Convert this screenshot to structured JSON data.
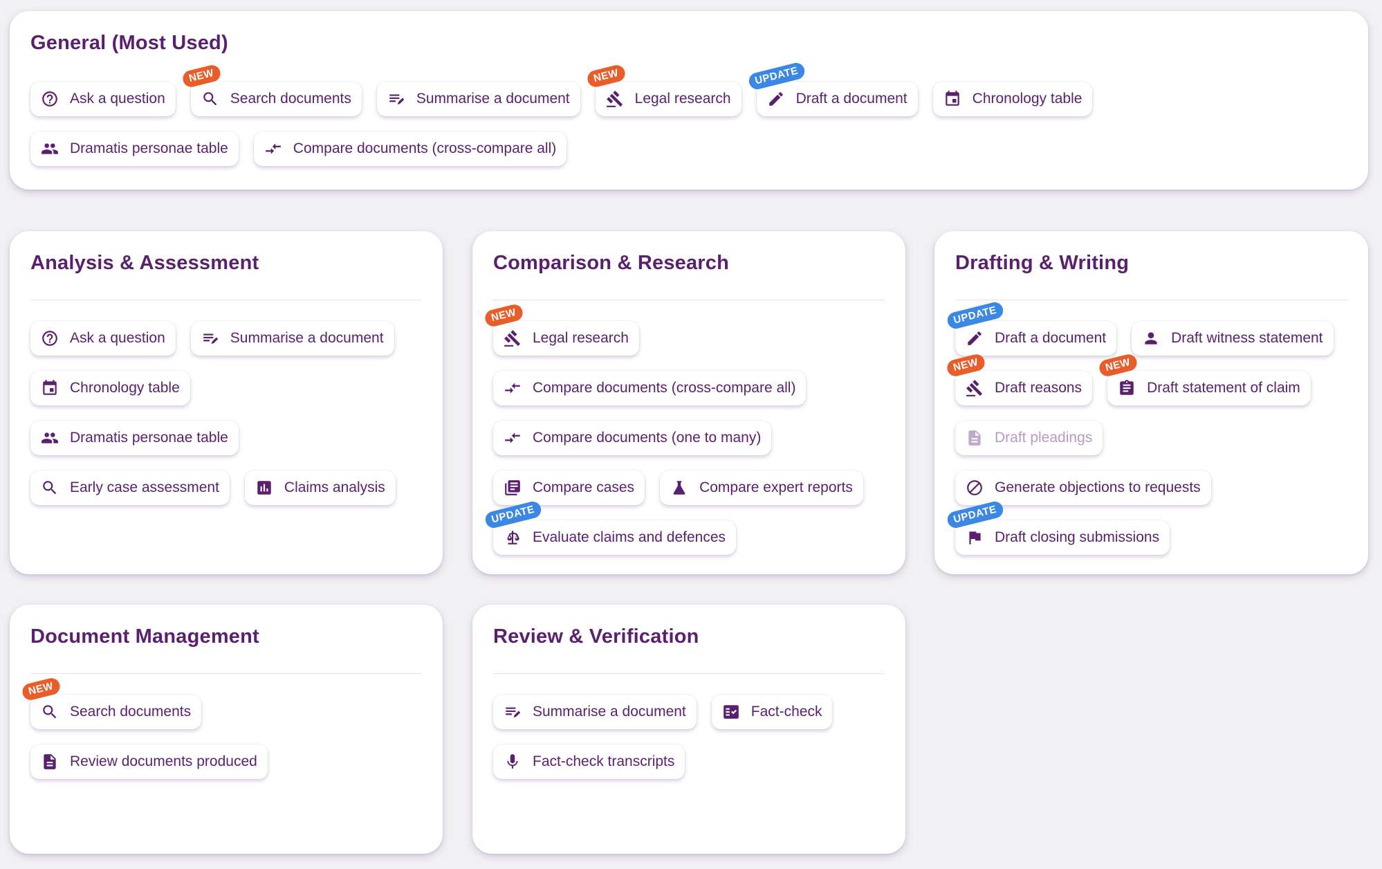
{
  "badges": {
    "new": "NEW",
    "update": "UPDATE"
  },
  "general": {
    "title": "General (Most Used)",
    "row1": [
      {
        "label": "Ask a question",
        "icon": "help-circle"
      },
      {
        "label": "Search documents",
        "icon": "search",
        "badge": "NEW"
      },
      {
        "label": "Summarise a document",
        "icon": "summarise"
      },
      {
        "label": "Legal research",
        "icon": "gavel",
        "badge": "NEW"
      },
      {
        "label": "Draft a document",
        "icon": "pencil",
        "badge": "UPDATE"
      },
      {
        "label": "Chronology table",
        "icon": "calendar"
      }
    ],
    "row2": [
      {
        "label": "Dramatis personae table",
        "icon": "people"
      },
      {
        "label": "Compare documents (cross-compare all)",
        "icon": "compare-arrows"
      }
    ]
  },
  "analysis": {
    "title": "Analysis & Assessment",
    "items": [
      {
        "label": "Ask a question",
        "icon": "help-circle"
      },
      {
        "label": "Summarise a document",
        "icon": "summarise"
      },
      {
        "label": "Chronology table",
        "icon": "calendar"
      },
      {
        "label": "Dramatis personae table",
        "icon": "people"
      },
      {
        "label": "Early case assessment",
        "icon": "search"
      },
      {
        "label": "Claims analysis",
        "icon": "bar-chart"
      }
    ]
  },
  "comparison": {
    "title": "Comparison & Research",
    "items": [
      {
        "label": "Legal research",
        "icon": "gavel",
        "badge": "NEW"
      },
      {
        "label": "Compare documents (cross-compare all)",
        "icon": "compare-arrows"
      },
      {
        "label": "Compare documents (one to many)",
        "icon": "compare-arrows"
      },
      {
        "label": "Compare cases",
        "icon": "library-books"
      },
      {
        "label": "Compare expert reports",
        "icon": "flask"
      },
      {
        "label": "Evaluate claims and defences",
        "icon": "scales",
        "badge": "UPDATE"
      }
    ]
  },
  "drafting": {
    "title": "Drafting & Writing",
    "items": [
      {
        "label": "Draft a document",
        "icon": "pencil",
        "badge": "UPDATE"
      },
      {
        "label": "Draft witness statement",
        "icon": "person"
      },
      {
        "label": "Draft reasons",
        "icon": "gavel",
        "badge": "NEW"
      },
      {
        "label": "Draft statement of claim",
        "icon": "clipboard",
        "badge": "NEW"
      },
      {
        "label": "Draft pleadings",
        "icon": "document",
        "disabled": true
      },
      {
        "label": "Generate objections to requests",
        "icon": "block"
      },
      {
        "label": "Draft closing submissions",
        "icon": "flag",
        "badge": "UPDATE"
      }
    ]
  },
  "docmgmt": {
    "title": "Document Management",
    "items": [
      {
        "label": "Search documents",
        "icon": "search",
        "badge": "NEW"
      },
      {
        "label": "Review documents produced",
        "icon": "document"
      }
    ]
  },
  "review": {
    "title": "Review & Verification",
    "items": [
      {
        "label": "Summarise a document",
        "icon": "summarise"
      },
      {
        "label": "Fact-check",
        "icon": "fact-check"
      },
      {
        "label": "Fact-check transcripts",
        "icon": "microphone"
      }
    ]
  }
}
